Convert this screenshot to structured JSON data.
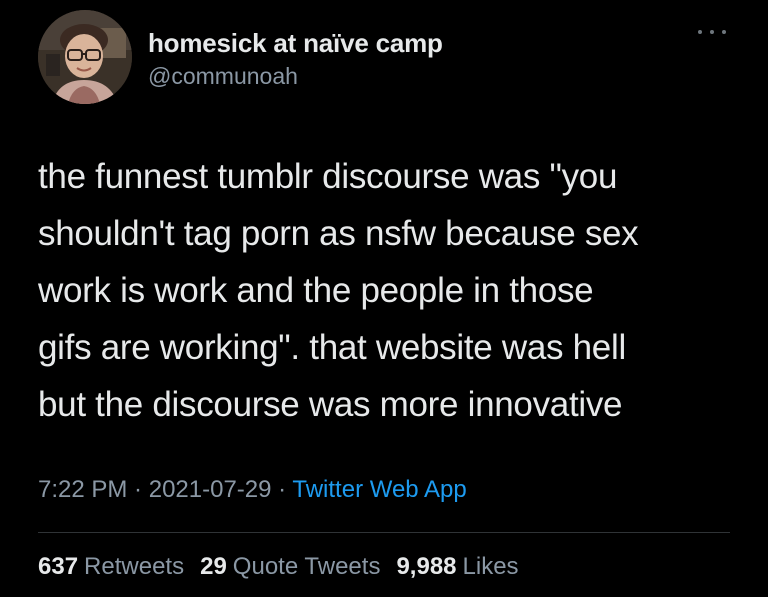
{
  "tweet": {
    "display_name": "homesick at naïve camp",
    "handle": "@communoah",
    "text": "the funnest tumblr discourse was \"you\nshouldn't tag porn as nsfw because sex\nwork is work and the people in those\ngifs are working\". that website was hell\nbut the discourse was more innovative",
    "time": "7:22 PM",
    "date": "2021-07-29",
    "separator": " · ",
    "source": "Twitter Web App"
  },
  "stats": {
    "retweets_count": "637",
    "retweets_label": "Retweets",
    "quotes_count": "29",
    "quotes_label": "Quote Tweets",
    "likes_count": "9,988",
    "likes_label": "Likes"
  },
  "colors": {
    "background": "#000000",
    "text": "#e7e9ea",
    "secondary_text": "#8b98a5",
    "link": "#1d9bf0",
    "divider": "#2f3336"
  },
  "icons": {
    "more": "more-horizontal-icon"
  }
}
